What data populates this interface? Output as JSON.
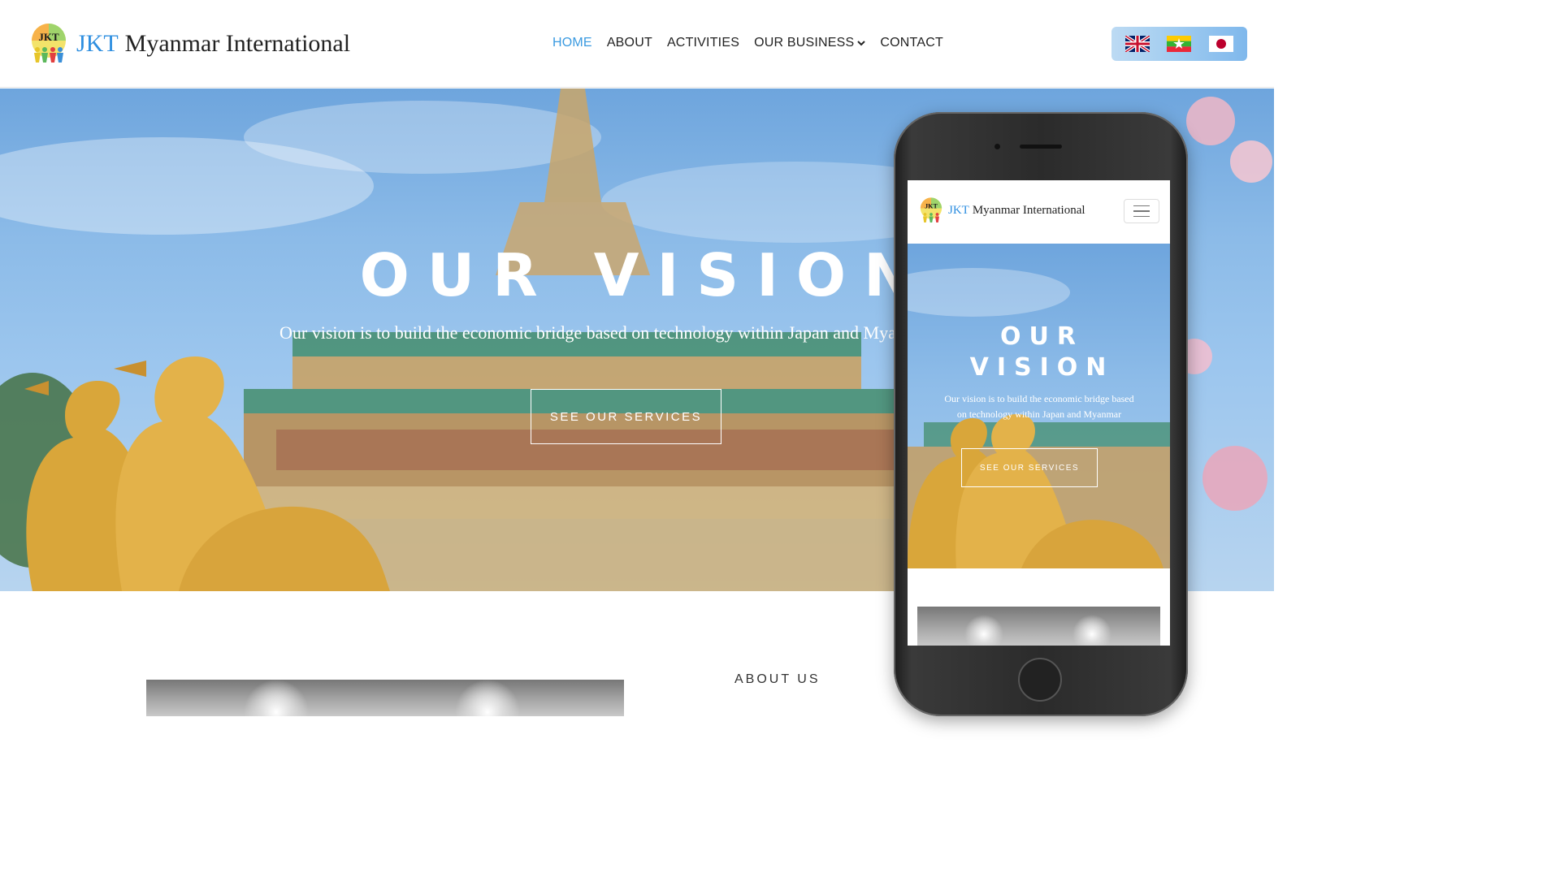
{
  "brand": {
    "badge_text": "JKT",
    "prefix": "JKT",
    "name": "Myanmar International"
  },
  "nav": {
    "items": [
      {
        "label": "HOME",
        "active": true
      },
      {
        "label": "ABOUT",
        "active": false
      },
      {
        "label": "ACTIVITIES",
        "active": false
      },
      {
        "label": "OUR BUSINESS",
        "active": false,
        "has_dropdown": true
      },
      {
        "label": "CONTACT",
        "active": false
      }
    ]
  },
  "languages": [
    "English (UK flag)",
    "Myanmar flag",
    "Japan flag"
  ],
  "hero": {
    "title": "OUR VISION",
    "subtitle": "Our vision is to build the economic bridge based on technology within Japan and Myanmar",
    "button": "SEE OUR SERVICES"
  },
  "about": {
    "label": "ABOUT US"
  },
  "mobile": {
    "hero_title_line1": "OUR",
    "hero_title_line2": "VISION",
    "hero_subtitle": "Our vision is to build the economic bridge based on technology within Japan and Myanmar",
    "hero_button": "SEE OUR SERVICES"
  },
  "colors": {
    "accent": "#3a9ae0",
    "brand_blue": "#2f8fe0",
    "sky": "#8cbbe8",
    "gold": "#d9a63a"
  }
}
